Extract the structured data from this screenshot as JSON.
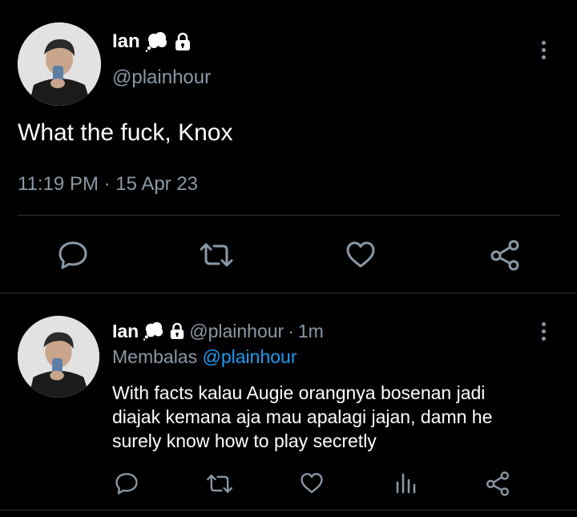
{
  "main_tweet": {
    "display_name": "Ian",
    "handle": "@plainhour",
    "text": "What the fuck, Knox",
    "timestamp": "11:19 PM · 15 Apr 23",
    "badges": [
      "thought-balloon-icon",
      "lock-icon"
    ]
  },
  "reply": {
    "display_name": "Ian",
    "handle": "@plainhour",
    "separator": "·",
    "time": "1m",
    "replying_prefix": "Membalas",
    "replying_to": "@plainhour",
    "text_lines": [
      "With facts kalau Augie orangnya bosenan jadi",
      "diajak kemana aja mau apalagi jajan, damn he",
      "surely know how to play secretly"
    ]
  },
  "actions": {
    "main": [
      "reply-icon",
      "retweet-icon",
      "like-icon",
      "share-icon"
    ],
    "reply": [
      "reply-icon",
      "retweet-icon",
      "like-icon",
      "analytics-icon",
      "share-icon"
    ]
  },
  "colors": {
    "background": "#000000",
    "text": "#e7e9ea",
    "muted": "#8b98a5",
    "link": "#1d9bf0",
    "divider": "#2f3336"
  }
}
